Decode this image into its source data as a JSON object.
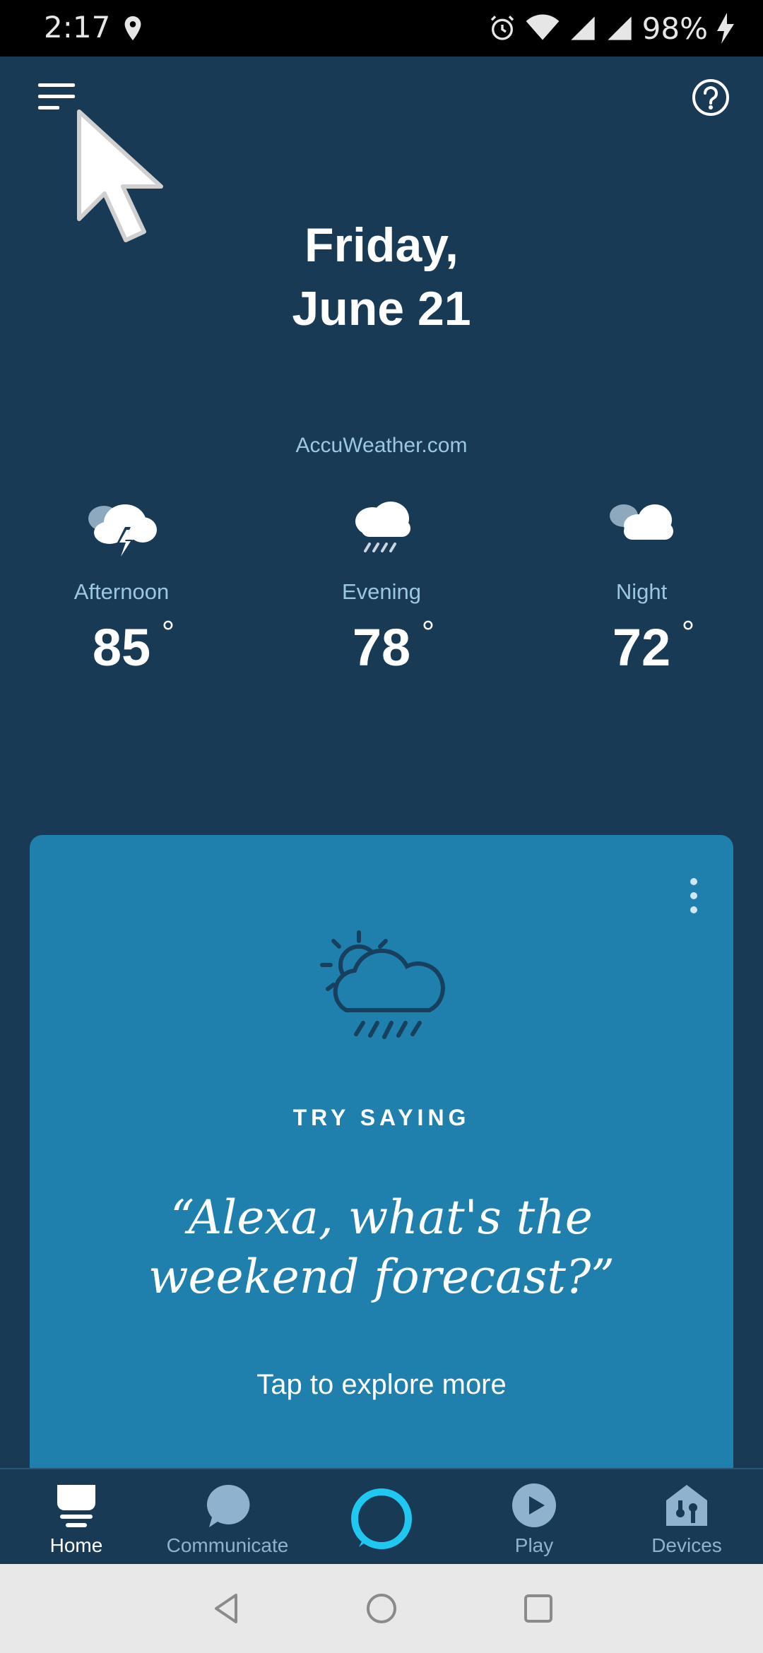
{
  "status_bar": {
    "time": "2:17",
    "battery": "98%"
  },
  "header": {
    "date_line1": "Friday,",
    "date_line2": "June 21"
  },
  "weather": {
    "source": "AccuWeather.com",
    "forecast": [
      {
        "label": "Afternoon",
        "temp": "85",
        "icon": "thunderstorm-icon"
      },
      {
        "label": "Evening",
        "temp": "78",
        "icon": "rain-icon"
      },
      {
        "label": "Night",
        "temp": "72",
        "icon": "cloudy-icon"
      }
    ],
    "degree_symbol": "°"
  },
  "card": {
    "heading": "TRY SAYING",
    "quote": "“Alexa, what's the weekend forecast?”",
    "explore": "Tap to explore more"
  },
  "bottom_nav": {
    "items": [
      {
        "label": "Home",
        "active": true
      },
      {
        "label": "Communicate"
      },
      {
        "label": "Play"
      },
      {
        "label": "Devices"
      }
    ]
  },
  "colors": {
    "background": "#183a55",
    "card": "#2080ad",
    "accent_alexa": "#1ec8f0"
  }
}
